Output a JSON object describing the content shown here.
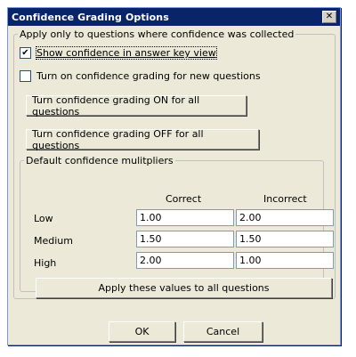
{
  "dialog": {
    "title": "Confidence Grading Options"
  },
  "outer_group": {
    "legend": "Apply only to questions where confidence was collected",
    "show_confidence": {
      "label": "Show confidence in answer key view",
      "checked": true
    },
    "turn_on_new": {
      "label": "Turn on confidence grading for new questions",
      "checked": false
    },
    "on_all_button": "Turn confidence grading ON for all questions",
    "off_all_button": "Turn confidence grading OFF for all questions"
  },
  "multipliers": {
    "legend": "Default confidence mulitpliers",
    "headers": [
      "Correct",
      "Incorrect"
    ],
    "rows": [
      {
        "label": "Low",
        "correct": "1.00",
        "incorrect": "2.00"
      },
      {
        "label": "Medium",
        "correct": "1.50",
        "incorrect": "1.50"
      },
      {
        "label": "High",
        "correct": "2.00",
        "incorrect": "1.00"
      }
    ],
    "apply_button": "Apply these values to all questions"
  },
  "footer": {
    "ok": "OK",
    "cancel": "Cancel"
  },
  "icons": {
    "close": "close-icon",
    "check": "check-icon"
  },
  "colors": {
    "titlebar": "#0a246a",
    "dialog_bg": "#ece9d8"
  }
}
